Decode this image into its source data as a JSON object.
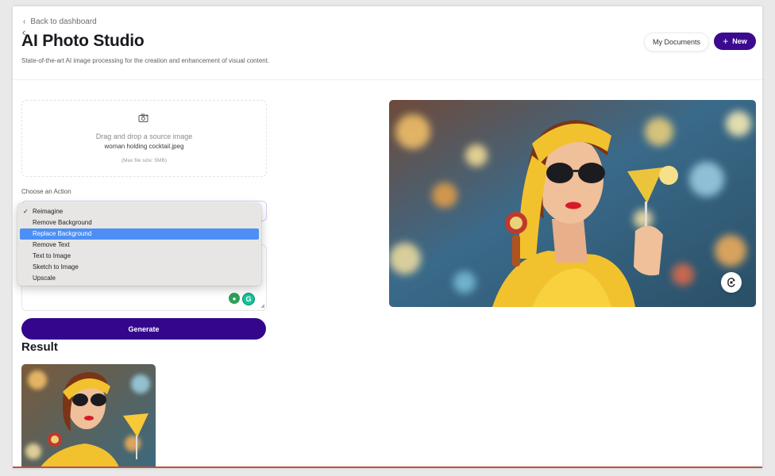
{
  "header": {
    "back_label": "Back to dashboard",
    "title": "AI Photo Studio",
    "subtitle": "State-of-the-art AI image processing for the creation and enhancement of visual content.",
    "my_documents_label": "My Documents",
    "new_label": "New"
  },
  "upload": {
    "drag_text": "Drag and drop a source image",
    "file_name": "woman holding cocktail.jpeg",
    "max_size": "(Max file size: 5MB)",
    "icon": "camera-plus-icon"
  },
  "action": {
    "label": "Choose an Action",
    "selected": "Reimagine",
    "highlighted": "Replace Background",
    "options": [
      "Reimagine",
      "Remove Background",
      "Replace Background",
      "Remove Text",
      "Text to Image",
      "Sketch to Image",
      "Upscale"
    ]
  },
  "generate_label": "Generate",
  "result_heading": "Result",
  "colors": {
    "brand": "#34068c",
    "highlight": "#4d8ff5",
    "headband": "#f2c12e",
    "lipstick": "#d61a2b"
  }
}
